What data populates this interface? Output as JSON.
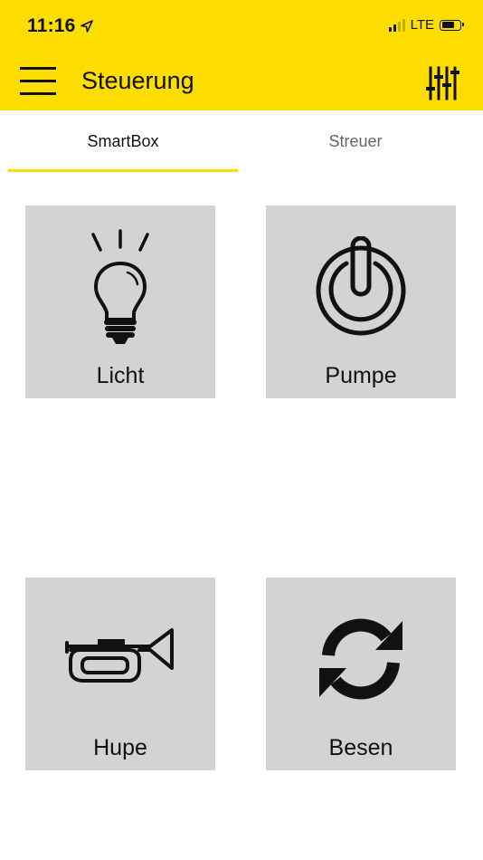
{
  "status_bar": {
    "time": "11:16",
    "network": "LTE",
    "location_icon": "location-arrow-icon",
    "signal_icon": "signal-bars-icon",
    "battery_icon": "battery-icon"
  },
  "header": {
    "title": "Steuerung",
    "menu_icon": "hamburger-menu-icon",
    "settings_icon": "sliders-icon",
    "background_color": "#fedd00"
  },
  "tabs": [
    {
      "label": "SmartBox",
      "active": true
    },
    {
      "label": "Streuer",
      "active": false
    }
  ],
  "tiles": [
    {
      "label": "Licht",
      "icon": "light-bulb-icon"
    },
    {
      "label": "Pumpe",
      "icon": "power-icon"
    },
    {
      "label": "Hupe",
      "icon": "horn-icon"
    },
    {
      "label": "Besen",
      "icon": "refresh-icon"
    }
  ],
  "colors": {
    "accent": "#fedd00",
    "tile_background": "#d3d3d3"
  }
}
